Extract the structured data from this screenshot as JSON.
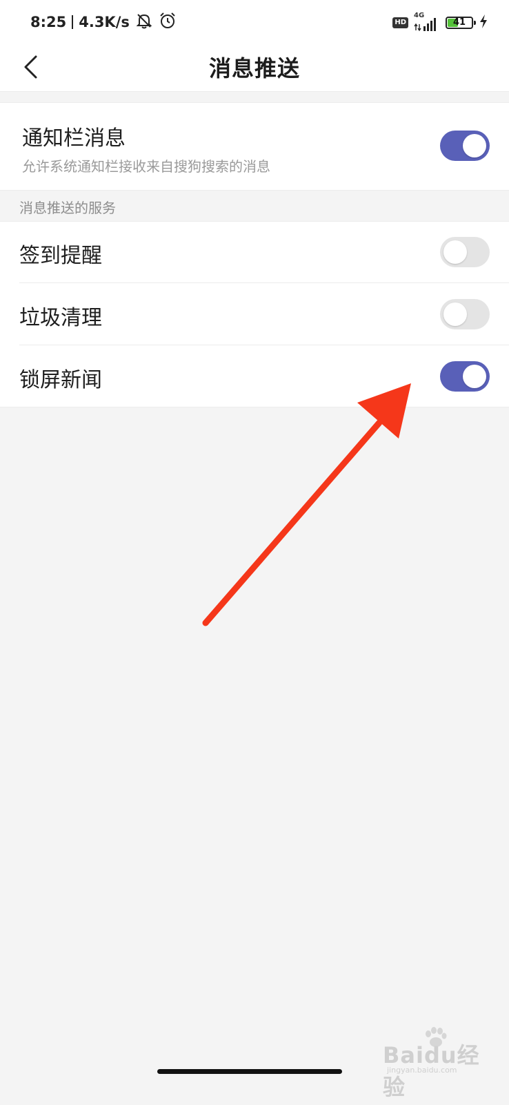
{
  "status_bar": {
    "time": "8:25",
    "speed": "4.3K/s",
    "hd_label": "HD",
    "network_label": "4G",
    "battery_level": "41",
    "battery_fraction": 0.41
  },
  "header": {
    "title": "消息推送"
  },
  "notification_bar": {
    "title": "通知栏消息",
    "description": "允许系统通知栏接收来自搜狗搜索的消息",
    "enabled": true
  },
  "section": {
    "label": "消息推送的服务"
  },
  "services": [
    {
      "label": "签到提醒",
      "enabled": false
    },
    {
      "label": "垃圾清理",
      "enabled": false
    },
    {
      "label": "锁屏新闻",
      "enabled": true
    }
  ],
  "colors": {
    "toggle_on": "#5960b8",
    "toggle_off": "#e4e4e4",
    "annotation_arrow": "#f5371a",
    "page_background": "#f4f4f4"
  },
  "icons": {
    "back": "back-chevron-icon",
    "mute": "bell-off-icon",
    "alarm": "alarm-clock-icon",
    "signal": "signal-bars-icon",
    "battery": "battery-icon",
    "charging": "charging-bolt-icon"
  },
  "watermark": {
    "text": "Baidu经验",
    "url": "jingyan.baidu.com"
  }
}
